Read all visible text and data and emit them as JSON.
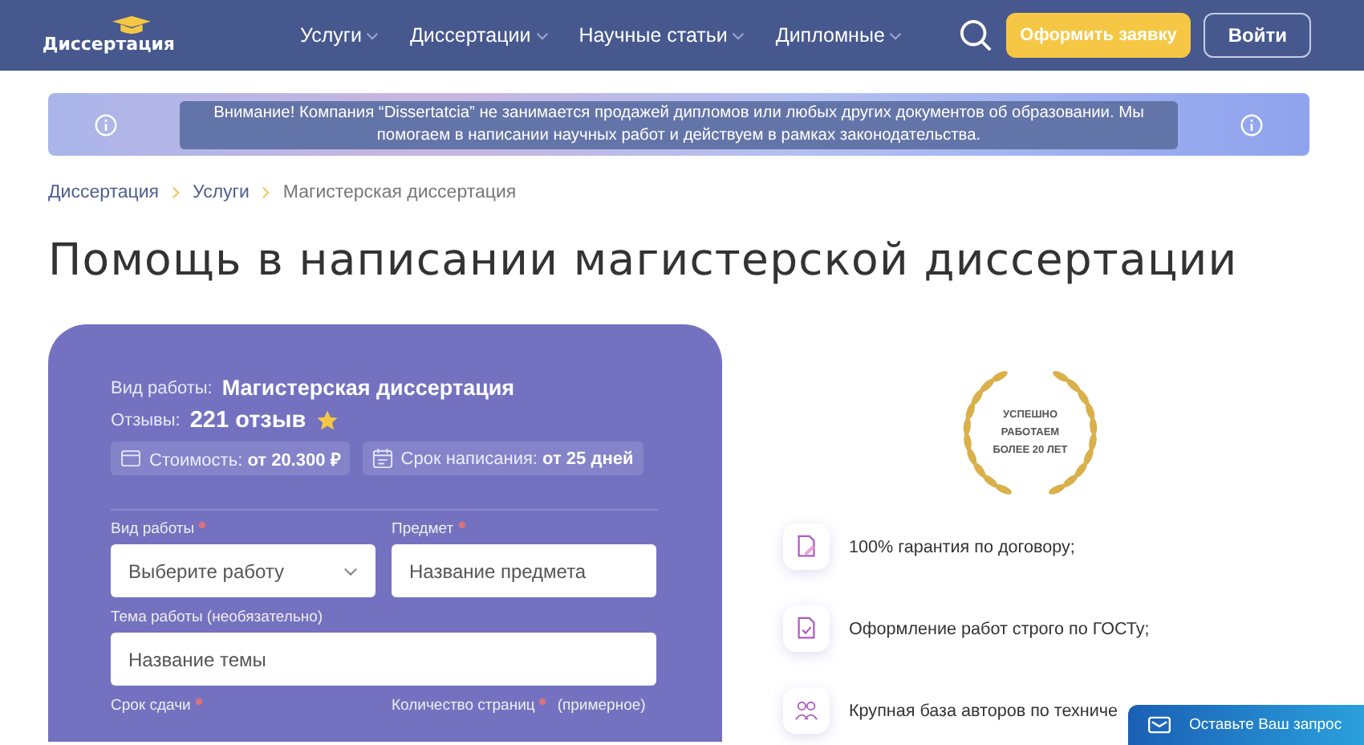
{
  "header": {
    "logo": "Диссертация",
    "nav": [
      {
        "label": "Услуги"
      },
      {
        "label": "Диссертации"
      },
      {
        "label": "Научные статьи"
      },
      {
        "label": "Дипломные"
      }
    ],
    "order_button": "Оформить заявку",
    "login_button": "Войти"
  },
  "notice": {
    "text": "Внимание! Компания “Dissertatcia” не занимается продажей дипломов или любых других документов об образовании. Мы помогаем в написании научных работ и действуем в рамках законодательства."
  },
  "breadcrumbs": [
    {
      "label": "Диссертация",
      "link": true
    },
    {
      "label": "Услуги",
      "link": true
    },
    {
      "label": "Магистерская диссертация",
      "link": false
    }
  ],
  "title": "Помощь в написании магистерской диссертации",
  "card": {
    "work_type_label": "Вид работы:",
    "work_type": "Магистерская диссертация",
    "reviews_label": "Отзывы:",
    "reviews": "221 отзыв",
    "price_label": "Стоимость:",
    "price": "от 20.300 ₽",
    "term_label": "Срок написания:",
    "term": "от 25 дней",
    "fields": [
      {
        "kind": "select",
        "label": "Вид работы",
        "required": true,
        "placeholder": "Выберите работу"
      },
      {
        "kind": "input",
        "label": "Предмет",
        "required": true,
        "placeholder": "Название предмета"
      },
      {
        "kind": "wide",
        "label": "Тема работы (необязательно)",
        "required": false,
        "placeholder": "Название темы"
      },
      {
        "kind": "label",
        "label": "Срок сдачи",
        "required": true
      },
      {
        "kind": "label",
        "label": "Количество страниц",
        "required": true,
        "note": "(примерное)"
      }
    ]
  },
  "badge": {
    "lines": [
      "УСПЕШНО",
      "РАБОТАЕМ",
      "БОЛЕЕ 20 ЛЕТ"
    ]
  },
  "features": [
    {
      "kind": "contract",
      "text": "100% гарантия по договору;"
    },
    {
      "kind": "document",
      "text": "Оформление работ строго по ГОСТу;"
    },
    {
      "kind": "authors",
      "text": "Крупная база авторов по техниче"
    }
  ],
  "request_button": "Оставьте Ваш запрос"
}
